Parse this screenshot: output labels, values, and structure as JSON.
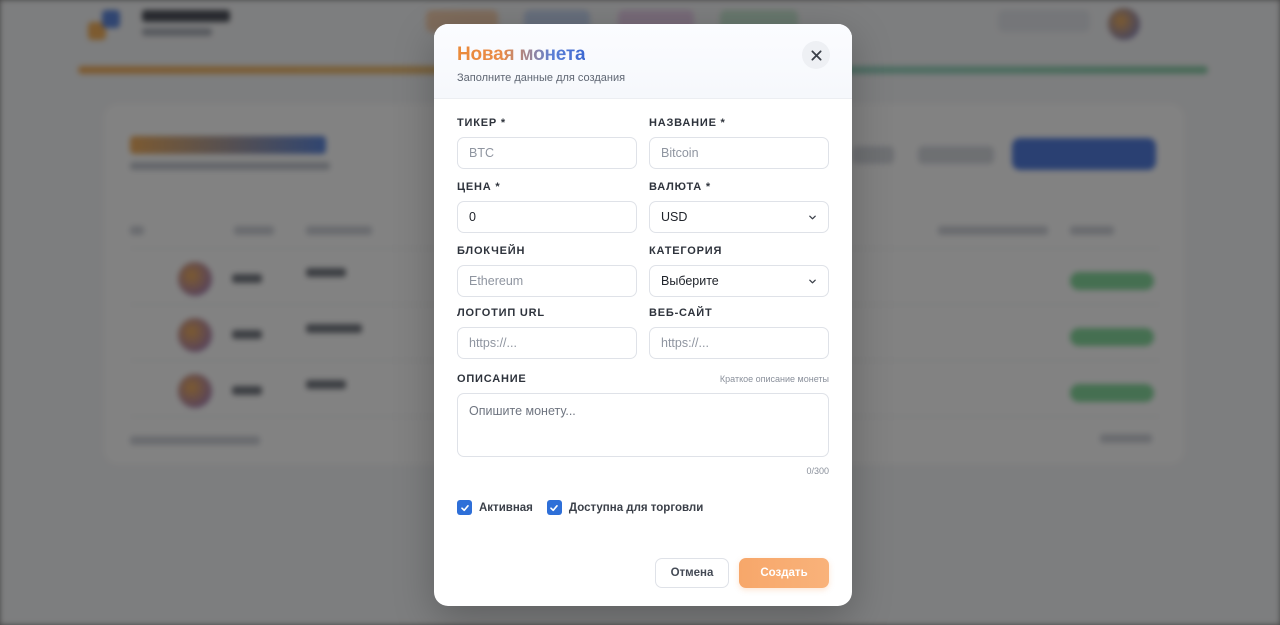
{
  "modal": {
    "title": "Новая монета",
    "subtitle": "Заполните данные для создания",
    "close_icon": "close-icon"
  },
  "form": {
    "ticker": {
      "label": "ТИКЕР *",
      "placeholder": "BTC",
      "value": ""
    },
    "name": {
      "label": "НАЗВАНИЕ *",
      "placeholder": "Bitcoin",
      "value": ""
    },
    "price": {
      "label": "ЦЕНА *",
      "value": "0"
    },
    "currency": {
      "label": "ВАЛЮТА *",
      "selected": "USD"
    },
    "blockchain": {
      "label": "БЛОКЧЕЙН",
      "placeholder": "Ethereum",
      "value": ""
    },
    "category": {
      "label": "КАТЕГОРИЯ",
      "selected": "Выберите"
    },
    "logo_url": {
      "label": "ЛОГОТИП URL",
      "placeholder": "https://...",
      "value": ""
    },
    "website": {
      "label": "ВЕБ-САЙТ",
      "placeholder": "https://...",
      "value": ""
    },
    "description": {
      "label": "ОПИСАНИЕ",
      "hint": "Краткое описание монеты",
      "placeholder": "Опишите монету...",
      "counter": "0/300"
    },
    "active": {
      "label": "Активная",
      "checked": true
    },
    "tradable": {
      "label": "Доступна для торговли",
      "checked": true
    }
  },
  "footer": {
    "cancel_label": "Отмена",
    "create_label": "Создать"
  },
  "colors": {
    "accent_orange": "#f7a76a",
    "accent_blue": "#2e6fd8",
    "title_gradient_start": "#ea8a3a",
    "title_gradient_end": "#3d68d1"
  }
}
